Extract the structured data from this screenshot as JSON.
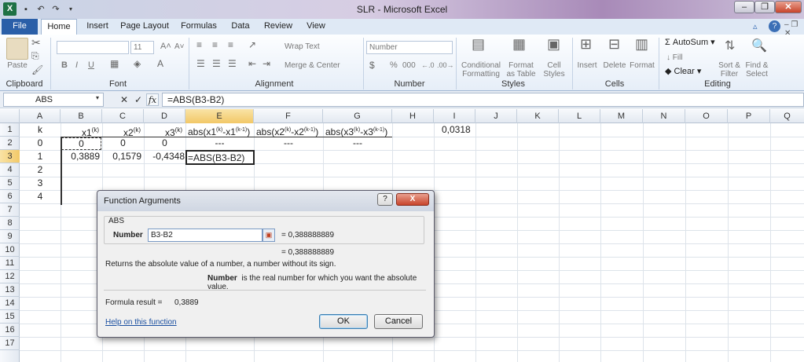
{
  "window": {
    "title": "SLR - Microsoft Excel",
    "app_icon": "X"
  },
  "tabs": [
    "File",
    "Home",
    "Insert",
    "Page Layout",
    "Formulas",
    "Data",
    "Review",
    "View"
  ],
  "ribbon": {
    "clipboard": {
      "paste": "Paste",
      "label": "Clipboard"
    },
    "font": {
      "size": "11",
      "label": "Font",
      "bold": "B",
      "italic": "I",
      "underline": "U"
    },
    "alignment": {
      "wrap": "Wrap Text",
      "merge": "Merge & Center",
      "label": "Alignment"
    },
    "number": {
      "format": "Number",
      "percent": "%",
      "label": "Number"
    },
    "styles": {
      "cond1": "Conditional",
      "cond2": "Formatting",
      "fmt1": "Format",
      "fmt2": "as Table",
      "cell1": "Cell",
      "cell2": "Styles",
      "label": "Styles"
    },
    "cells": {
      "insert": "Insert",
      "delete": "Delete",
      "format": "Format",
      "label": "Cells"
    },
    "editing": {
      "autosum": "AutoSum",
      "fill": "Fill",
      "clear": "Clear",
      "sort1": "Sort &",
      "sort2": "Filter",
      "find1": "Find &",
      "find2": "Select",
      "label": "Editing"
    }
  },
  "formula_bar": {
    "name_box": "ABS",
    "formula": "=ABS(B3-B2)",
    "fx": "fx"
  },
  "columns": [
    "A",
    "B",
    "C",
    "D",
    "E",
    "F",
    "G",
    "H",
    "I",
    "J",
    "K",
    "L",
    "M",
    "N",
    "O",
    "P",
    "Q"
  ],
  "rows": [
    "1",
    "2",
    "3",
    "4",
    "5",
    "6",
    "7",
    "8",
    "9",
    "10",
    "11",
    "12",
    "13",
    "14",
    "15",
    "16",
    "17"
  ],
  "cells": {
    "A1": "k",
    "B1": "x1",
    "B1s": "(k)",
    "C1": "x2",
    "C1s": "(k)",
    "D1": "x3",
    "D1s": "(k)",
    "E1a": "abs(x1",
    "E1s1": "(k)",
    "E1b": "-x1",
    "E1s2": "(k-1)",
    "E1c": ")",
    "F1a": "abs(x2",
    "F1s1": "(k)",
    "F1b": "-x2",
    "F1s2": "(k-1)",
    "F1c": ")",
    "G1a": "abs(x3",
    "G1s1": "(k)",
    "G1b": "-x3",
    "G1s2": "(k-1)",
    "G1c": ")",
    "I1": "0,0318",
    "A2": "0",
    "B2": "0",
    "C2": "0",
    "D2": "0",
    "E2": "---",
    "F2": "---",
    "G2": "---",
    "A3": "1",
    "B3": "0,3889",
    "C3": "0,1579",
    "D3": "-0,4348",
    "E3": "=ABS(B3-B2)",
    "A4": "2",
    "A5": "3",
    "A6": "4"
  },
  "dialog": {
    "title": "Function Arguments",
    "function": "ABS",
    "arg_label": "Number",
    "arg_value": "B3-B2",
    "arg_result": "= 0,388888889",
    "total_result": "= 0,388888889",
    "description": "Returns the absolute value of a number, a number without its sign.",
    "arg_desc_name": "Number",
    "arg_desc": "is the real number for which you want the absolute value.",
    "formula_result_label": "Formula result =",
    "formula_result": "0,3889",
    "help": "Help on this function",
    "ok": "OK",
    "cancel": "Cancel",
    "help_btn": "?",
    "close_btn": "X"
  }
}
